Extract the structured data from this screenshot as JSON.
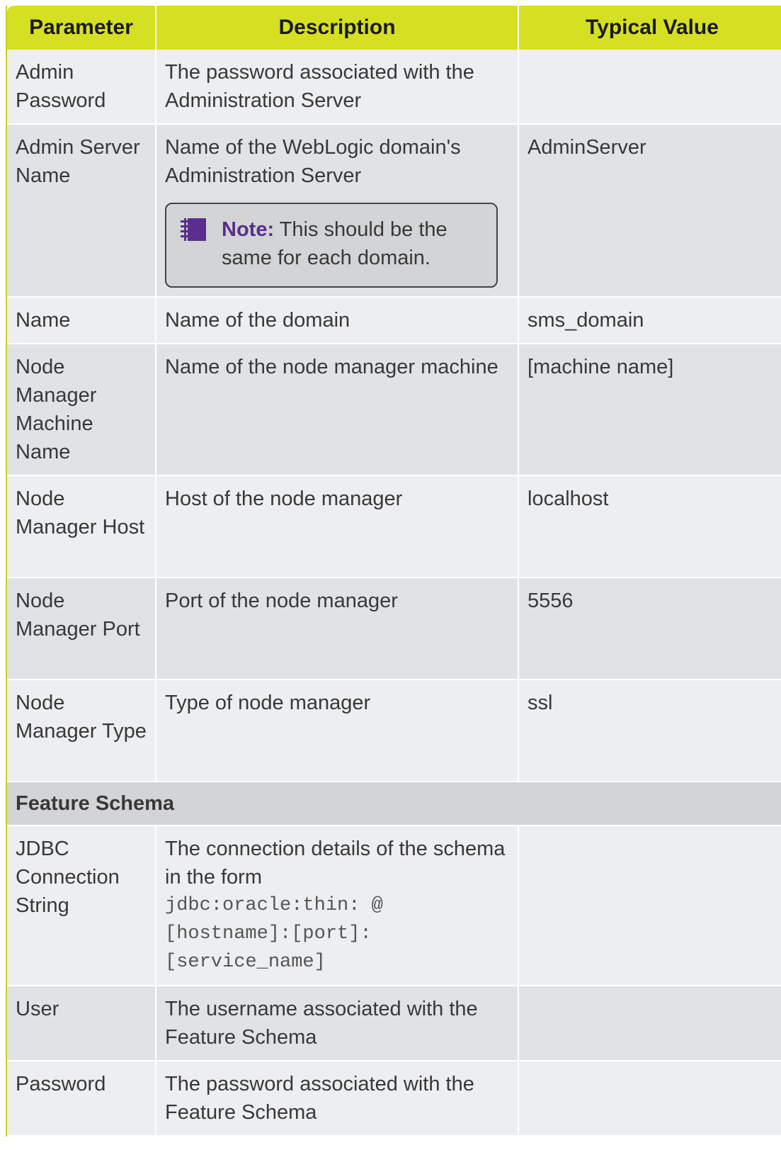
{
  "header": {
    "col_parameter": "Parameter",
    "col_description": "Description",
    "col_typical": "Typical Value"
  },
  "rows": [
    {
      "parameter": "Admin Password",
      "description": "The password associated with the Administration Server",
      "typical": ""
    },
    {
      "parameter": "Admin Server Name",
      "description": "Name of the WebLogic domain's Administration Server",
      "typical": "AdminServer",
      "note": {
        "label": "Note:",
        "text": "This should be the same for each domain.",
        "icon": "notebook-icon"
      }
    },
    {
      "parameter": "Name",
      "description": "Name of the domain",
      "typical": "sms_domain"
    },
    {
      "parameter": "Node Manager Machine Name",
      "description": "Name of the node manager machine",
      "typical": "[machine name]"
    },
    {
      "parameter": "Node Manager Host",
      "description": "Host of the node manager",
      "typical": "localhost"
    },
    {
      "parameter": "Node Manager Port",
      "description": "Port of the node manager",
      "typical": "5556"
    },
    {
      "parameter": "Node Manager Type",
      "description": "Type of node manager",
      "typical": "ssl"
    }
  ],
  "section": {
    "title": "Feature Schema"
  },
  "schema_rows": [
    {
      "parameter": "JDBC Connection String",
      "description": "The connection details of the schema in the form",
      "code": "jdbc:oracle:thin: @ [hostname]:[port]: [service_name]",
      "typical": ""
    },
    {
      "parameter": "User",
      "description": "The username associated with the Feature Schema",
      "typical": ""
    },
    {
      "parameter": "Password",
      "description": "The password associated with the Feature Schema",
      "typical": ""
    }
  ],
  "colors": {
    "header_bg": "#d6e022",
    "note_label": "#5b2d8e",
    "row_a": "#eceef0",
    "row_b": "#e0e3e6"
  }
}
